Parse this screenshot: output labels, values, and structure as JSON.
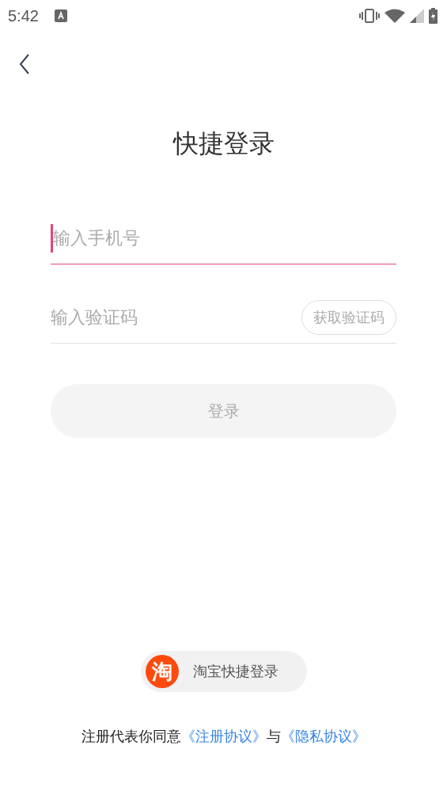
{
  "status_bar": {
    "time": "5:42"
  },
  "title": "快捷登录",
  "phone_field": {
    "placeholder": "输入手机号",
    "focused": true
  },
  "code_field": {
    "placeholder": "输入验证码",
    "focused": false
  },
  "get_code_button": {
    "label": "获取验证码",
    "disabled": true
  },
  "login_button": {
    "label": "登录",
    "disabled": true
  },
  "taobao_login": {
    "icon_text": "淘",
    "label": "淘宝快捷登录"
  },
  "agreement": {
    "text": "注册代表你同意",
    "links": [
      "《注册协议》",
      "《隐私协议》"
    ],
    "joiner": "与"
  }
}
